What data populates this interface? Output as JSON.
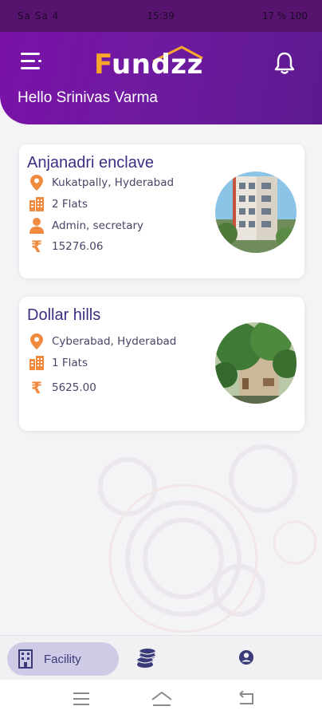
{
  "status_bar": {
    "left": "Sa Sa 4",
    "time": "15:39",
    "right": "17 % 100"
  },
  "header": {
    "logo": "Fundzz",
    "greeting": "Hello Srinivas Varma"
  },
  "properties": [
    {
      "name": "Anjanadri enclave",
      "location": "Kukatpally, Hyderabad",
      "flats": "2 Flats",
      "role": "Admin, secretary",
      "amount": "15276.06"
    },
    {
      "name": "Dollar hills",
      "location": "Cyberabad, Hyderabad",
      "flats": "1 Flats",
      "amount": "5625.00"
    }
  ],
  "bottom_nav": {
    "facility_label": "Facility"
  },
  "icons": {
    "menu": "menu-icon",
    "notification": "bell-icon",
    "location": "location-pin-icon",
    "flats": "building-icon",
    "role": "person-icon",
    "amount": "rupee-icon",
    "payments": "coins-icon",
    "profile": "account-icon"
  },
  "colors": {
    "header": "#7a12a8",
    "accent": "#f08a3e",
    "title": "#3a2f82",
    "nav_active": "#cfcbe7"
  }
}
